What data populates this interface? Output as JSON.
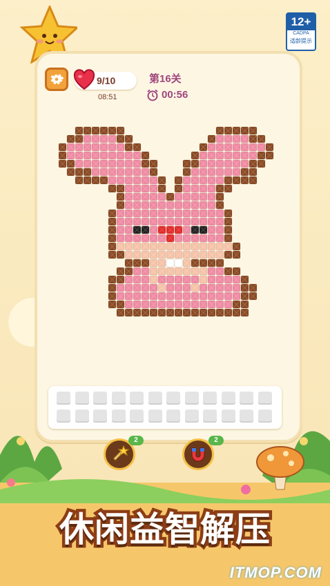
{
  "hud": {
    "lives": "9/10",
    "lives_timer": "08:51",
    "level": "第16关",
    "timer": "00:56"
  },
  "age_rating": {
    "num": "12+",
    "org": "CADPA",
    "tip": "适龄提示"
  },
  "boosters": [
    {
      "icon": "magic-wand-icon",
      "count": "2"
    },
    {
      "icon": "magnet-icon",
      "count": "2"
    }
  ],
  "slogan": "休闲益智解压",
  "watermark": "ITMOP.COM",
  "colors": {
    "pink": "#f08aa3",
    "light_pink": "#f7b5c2",
    "brown": "#8a4a24",
    "peach": "#f6c3a8",
    "red": "#e32a2a",
    "black": "#222222",
    "white": "#ffffff"
  },
  "tray": {
    "rows": 2,
    "slots_per_row": 12
  }
}
